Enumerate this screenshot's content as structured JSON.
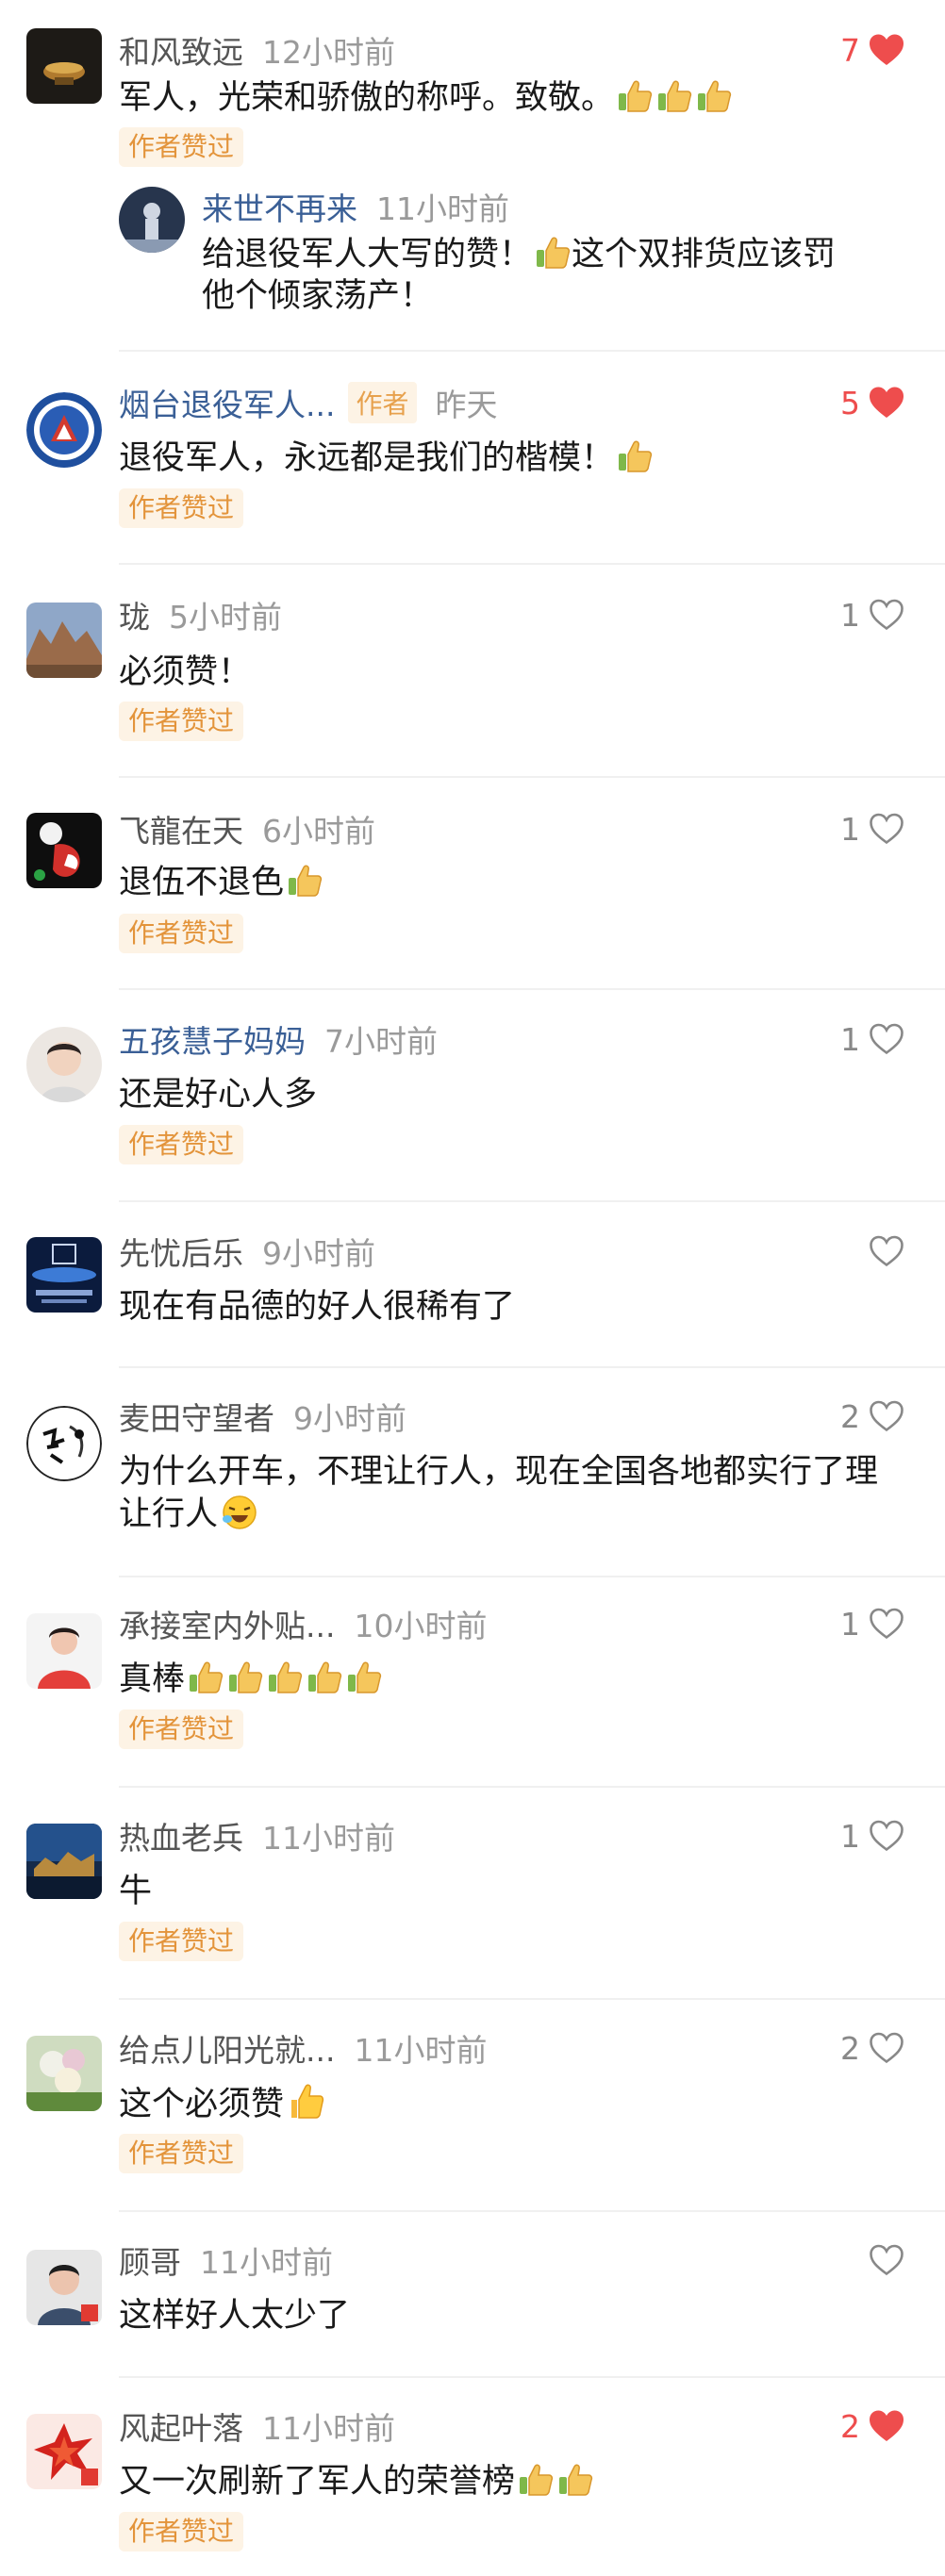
{
  "author_liked_label": "作者赞过",
  "comments": [
    {
      "name": "和风致远",
      "time": "12小时前",
      "text": "军人，光荣和骄傲的称呼。致敬。",
      "likes": "7",
      "liked": true,
      "reply": {
        "name": "来世不再来",
        "time": "11小时前",
        "text_a": "给退役军人大写的赞！",
        "text_b": "这个双排货应该罚他个倾家荡产！"
      }
    },
    {
      "name": "烟台退役军人...",
      "author_tag": "作者",
      "time": "昨天",
      "text": "退役军人，永远都是我们的楷模！",
      "likes": "5",
      "liked": true
    },
    {
      "name": "珑",
      "time": "5小时前",
      "text": "必须赞！",
      "likes": "1",
      "liked": false
    },
    {
      "name": "飞龍在天",
      "time": "6小时前",
      "text": "退伍不退色",
      "likes": "1",
      "liked": false
    },
    {
      "name": "五孩慧子妈妈",
      "time": "7小时前",
      "text": "还是好心人多",
      "likes": "1",
      "liked": false
    },
    {
      "name": "先忧后乐",
      "time": "9小时前",
      "text": "现在有品德的好人很稀有了",
      "likes": "",
      "liked": false
    },
    {
      "name": "麦田守望者",
      "time": "9小时前",
      "text": "为什么开车，不理让行人，现在全国各地都实行了理让行人",
      "likes": "2",
      "liked": false
    },
    {
      "name": "承接室内外贴...",
      "time": "10小时前",
      "text": "真棒",
      "likes": "1",
      "liked": false
    },
    {
      "name": "热血老兵",
      "time": "11小时前",
      "text": "牛",
      "likes": "1",
      "liked": false
    },
    {
      "name": "给点儿阳光就...",
      "time": "11小时前",
      "text": "这个必须赞",
      "likes": "2",
      "liked": false
    },
    {
      "name": "顾哥",
      "time": "11小时前",
      "text": "这样好人太少了",
      "likes": "",
      "liked": false
    },
    {
      "name": "风起叶落",
      "time": "11小时前",
      "text": "又一次刷新了军人的荣誉榜",
      "likes": "2",
      "liked": true
    }
  ],
  "colors": {
    "accent_red": "#ee4d4d",
    "author_tag_orange": "#e3943b",
    "reply_name_blue": "#3a5f96"
  },
  "icons": [
    "heart-filled-icon",
    "heart-outline-icon",
    "thumbs-up-emoji-icon",
    "laughing-emoji-icon"
  ]
}
